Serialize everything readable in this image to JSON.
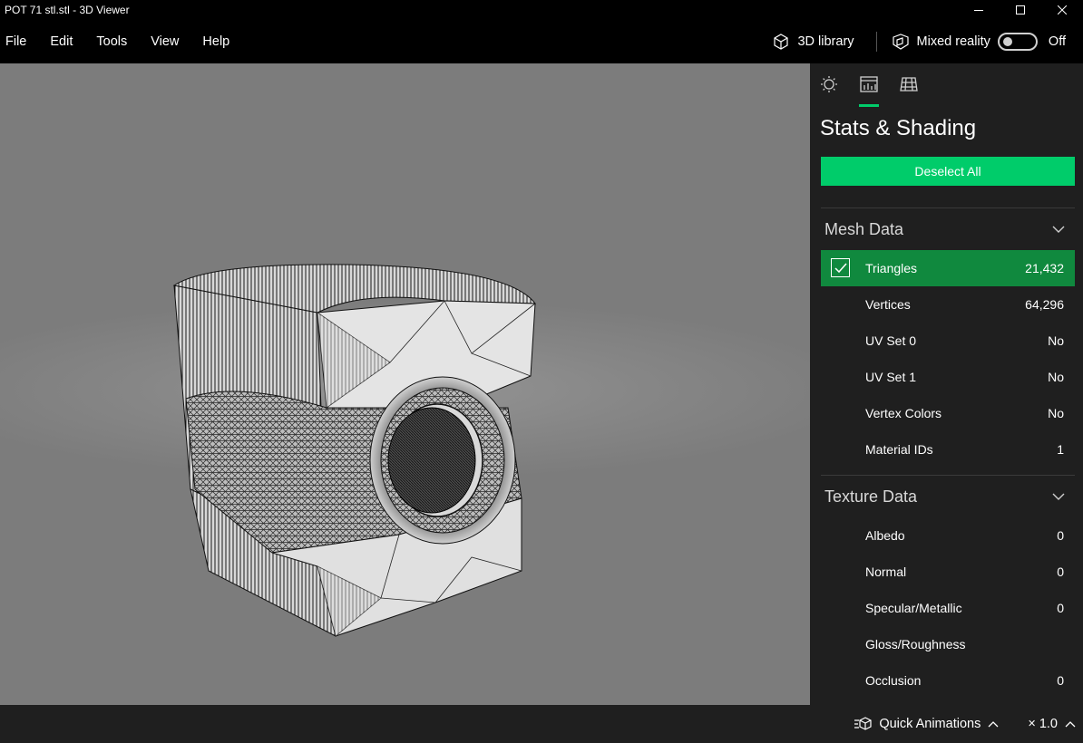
{
  "window": {
    "title": "POT 71 stl.stl - 3D Viewer"
  },
  "menu": {
    "items": [
      "File",
      "Edit",
      "Tools",
      "View",
      "Help"
    ]
  },
  "toolbar": {
    "library_label": "3D library",
    "mixed_reality_label": "Mixed reality",
    "mixed_reality_state": "Off"
  },
  "panel": {
    "tabs": [
      "lighting-icon",
      "stats-icon",
      "grid-icon"
    ],
    "active_tab": "stats-icon",
    "title": "Stats & Shading",
    "deselect_label": "Deselect All",
    "mesh_section": "Mesh Data",
    "mesh_rows": [
      {
        "label": "Triangles",
        "value": "21,432",
        "checked": true
      },
      {
        "label": "Vertices",
        "value": "64,296"
      },
      {
        "label": "UV Set 0",
        "value": "No"
      },
      {
        "label": "UV Set 1",
        "value": "No"
      },
      {
        "label": "Vertex Colors",
        "value": "No"
      },
      {
        "label": "Material IDs",
        "value": "1"
      }
    ],
    "texture_section": "Texture Data",
    "texture_rows": [
      {
        "label": "Albedo",
        "value": "0"
      },
      {
        "label": "Normal",
        "value": "0"
      },
      {
        "label": "Specular/Metallic",
        "value": "0"
      },
      {
        "label": "Gloss/Roughness",
        "value": ""
      },
      {
        "label": "Occlusion",
        "value": "0"
      }
    ]
  },
  "bottom": {
    "quick_animations": "Quick Animations",
    "speed": "× 1.0"
  },
  "colors": {
    "accent": "#00cc6a",
    "selected_row": "#10893e",
    "panel_bg": "#1f1f1f"
  }
}
